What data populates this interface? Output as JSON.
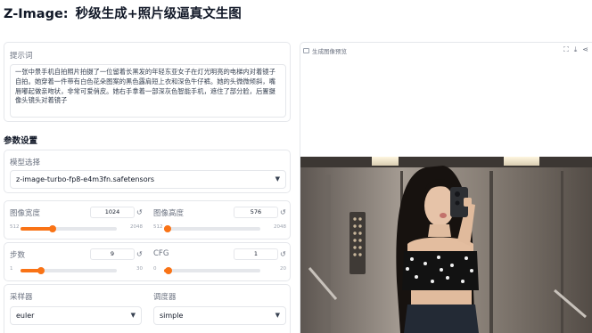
{
  "app": {
    "title_prefix": "Z-Image:",
    "title_main": "秒级生成+照片级逼真文生图"
  },
  "prompt": {
    "label": "提示词",
    "value": "一张中景手机自拍照片拍摄了一位留着长黑发的年轻东亚女子在灯光明亮的电梯内对着镜子自拍。她穿着一件带有白色花朵图案的黑色露肩短上衣和深色牛仔裤。她的头微微倾斜，嘴唇嘟起做亲吻状，非常可爱俏皮。她右手拿着一部深灰色智能手机，遮住了部分脸，后置摄像头镜头对着镜子"
  },
  "settings": {
    "label": "参数设置"
  },
  "model": {
    "label": "模型选择",
    "value": "z-image-turbo-fp8-e4m3fn.safetensors"
  },
  "sliders": {
    "width": {
      "label": "图像宽度",
      "value": "1024",
      "min": "512",
      "max": "2048",
      "fraction": 0.33
    },
    "height": {
      "label": "图像高度",
      "value": "576",
      "min": "512",
      "max": "2048",
      "fraction": 0.04
    },
    "steps": {
      "label": "步数",
      "value": "9",
      "min": "1",
      "max": "30",
      "fraction": 0.21
    },
    "cfg": {
      "label": "CFG",
      "value": "1",
      "min": "0",
      "max": "20",
      "fraction": 0.05
    }
  },
  "sampler": {
    "label": "采样器",
    "value": "euler"
  },
  "scheduler": {
    "label": "调度器",
    "value": "simple"
  },
  "output": {
    "label": "生成图像预览"
  },
  "icons": [
    "fullscreen-icon",
    "download-icon",
    "share-icon",
    "reset-icon",
    "chevron-down-icon",
    "image-icon"
  ],
  "colors": {
    "accent": "#f97316"
  }
}
